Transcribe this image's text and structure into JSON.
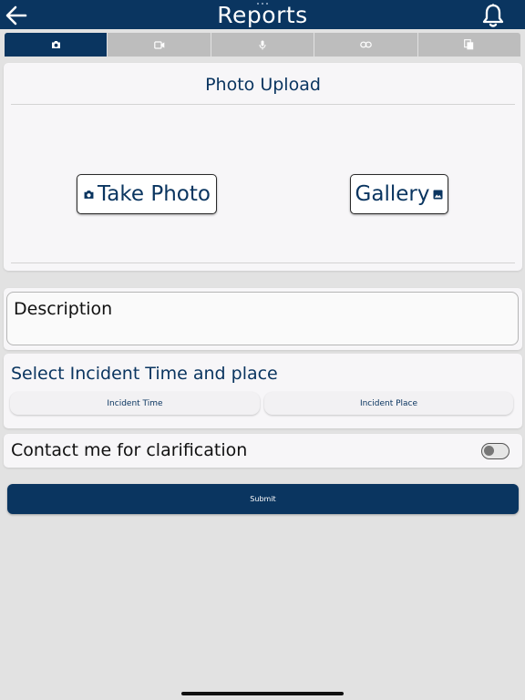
{
  "header": {
    "title": "Reports"
  },
  "tabs": [
    {
      "icon": "camera-icon",
      "active": true
    },
    {
      "icon": "video-camera-icon",
      "active": false
    },
    {
      "icon": "microphone-icon",
      "active": false
    },
    {
      "icon": "link-icon",
      "active": false
    },
    {
      "icon": "documents-icon",
      "active": false
    }
  ],
  "upload": {
    "title": "Photo Upload",
    "take_photo_label": "Take Photo",
    "gallery_label": "Gallery"
  },
  "description": {
    "placeholder": "Description"
  },
  "incident": {
    "title": "Select Incident Time and place",
    "time_label": "Incident Time",
    "place_label": "Incident Place"
  },
  "contact": {
    "label": "Contact me for clarification",
    "enabled": false
  },
  "submit": {
    "label": "Submit"
  },
  "colors": {
    "primary": "#0a3560",
    "tab_inactive": "#bdbdbd",
    "background": "#e2e2e2",
    "card": "#f7f6f8"
  }
}
